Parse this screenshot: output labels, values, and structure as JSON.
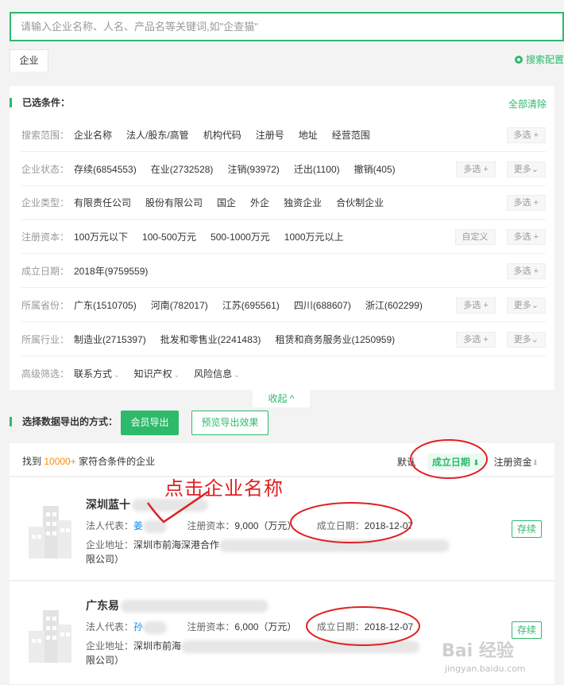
{
  "search": {
    "placeholder": "请输入企业名称、人名、产品名等关键词,如\"企查猫\""
  },
  "tabs": [
    {
      "label": "企业"
    }
  ],
  "search_config_label": "搜索配置",
  "filters": {
    "title": "已选条件：",
    "clear_all": "全部清除",
    "rows": [
      {
        "label": "搜索范围：",
        "options": [
          "企业名称",
          "法人/股东/高管",
          "机构代码",
          "注册号",
          "地址",
          "经营范围"
        ],
        "buttons": [
          "多选 +"
        ]
      },
      {
        "label": "企业状态：",
        "options": [
          "存续(6854553)",
          "在业(2732528)",
          "注销(93972)",
          "迁出(1100)",
          "撤销(405)"
        ],
        "buttons": [
          "多选 +",
          "更多⌄"
        ]
      },
      {
        "label": "企业类型：",
        "options": [
          "有限责任公司",
          "股份有限公司",
          "国企",
          "外企",
          "独资企业",
          "合伙制企业"
        ],
        "buttons": [
          "多选 +"
        ]
      },
      {
        "label": "注册资本：",
        "options": [
          "100万元以下",
          "100-500万元",
          "500-1000万元",
          "1000万元以上"
        ],
        "buttons": [
          "自定义",
          "多选 +"
        ]
      },
      {
        "label": "成立日期：",
        "options": [
          "2018年(9759559)"
        ],
        "buttons": [
          "多选 +"
        ]
      },
      {
        "label": "所属省份：",
        "options": [
          "广东(1510705)",
          "河南(782017)",
          "江苏(695561)",
          "四川(688607)",
          "浙江(602299)"
        ],
        "buttons": [
          "多选 +",
          "更多⌄"
        ]
      },
      {
        "label": "所属行业：",
        "options": [
          "制造业(2715397)",
          "批发和零售业(2241483)",
          "租赁和商务服务业(1250959)"
        ],
        "buttons": [
          "多选 +",
          "更多⌄"
        ]
      },
      {
        "label": "高级筛选：",
        "options": [
          "联系方式",
          "知识产权",
          "风险信息"
        ],
        "buttons": []
      }
    ],
    "collapse_label": "收起 ^"
  },
  "export": {
    "title": "选择数据导出的方式：",
    "member_button": "会员导出",
    "preview_button": "预览导出效果"
  },
  "results": {
    "found_prefix": "找到",
    "found_count": "10000+",
    "found_suffix": "家符合条件的企业",
    "sort_default": "默认",
    "sort_date": "成立日期",
    "sort_date_arrow": "⬇",
    "sort_capital": "注册资金",
    "sort_capital_arrow": "⬇"
  },
  "companies": [
    {
      "name": "深圳蓝十",
      "legal_label": "法人代表：",
      "legal_name": "姜",
      "capital_label": "注册资本：",
      "capital": "9,000（万元）",
      "date_label": "成立日期：",
      "date": "2018-12-07",
      "addr_label": "企业地址：",
      "addr": "深圳市前海深港合作",
      "addr_tail": "限公司）",
      "status": "存续"
    },
    {
      "name": "广东易",
      "legal_label": "法人代表：",
      "legal_name": "孙",
      "capital_label": "注册资本：",
      "capital": "6,000（万元）",
      "date_label": "成立日期：",
      "date": "2018-12-07",
      "addr_label": "企业地址：",
      "addr": "深圳市前海",
      "addr_tail": "限公司）",
      "status": "存续"
    }
  ],
  "annotation": {
    "text": "点击企业名称",
    "color": "#e02020"
  },
  "watermark": {
    "main": "Bai 经验",
    "sub": "jingyan.baidu.com"
  },
  "colors": {
    "accent": "#2dba6b",
    "link": "#128bed",
    "highlight": "#fd8a00"
  }
}
